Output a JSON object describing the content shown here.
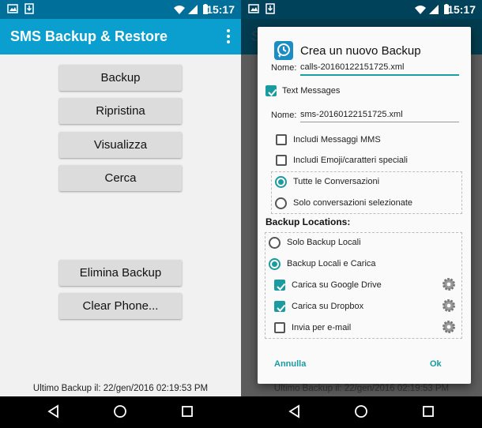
{
  "status": {
    "time": "15:17"
  },
  "app": {
    "title": "SMS Backup & Restore"
  },
  "main": {
    "buttons": {
      "backup": "Backup",
      "restore": "Ripristina",
      "view": "Visualizza",
      "search": "Cerca",
      "delete": "Elimina Backup",
      "clear": "Clear Phone..."
    },
    "last_backup": "Ultimo Backup il: 22/gen/2016 02:19:53 PM"
  },
  "dialog": {
    "title": "Crea un nuovo Backup",
    "name_label": "Nome:",
    "calls_filename": "calls-20160122151725.xml",
    "text_messages_label": "Text Messages",
    "sms_filename": "sms-20160122151725.xml",
    "include_mms": "Includi Messaggi MMS",
    "include_emoji": "Includi Emoji/caratteri speciali",
    "all_conversations": "Tutte le Conversazioni",
    "selected_conversations": "Solo conversazioni selezionate",
    "locations_heading": "Backup Locations:",
    "local_only": "Solo Backup Locali",
    "local_and_upload": "Backup Locali e Carica",
    "google_drive": "Carica su Google Drive",
    "dropbox": "Carica su Dropbox",
    "email": "Invia per e-mail",
    "cancel": "Annulla",
    "ok": "Ok"
  },
  "colors": {
    "statusbar": "#00709a",
    "appbar": "#0a9fcf",
    "accent": "#1a9ba0"
  }
}
